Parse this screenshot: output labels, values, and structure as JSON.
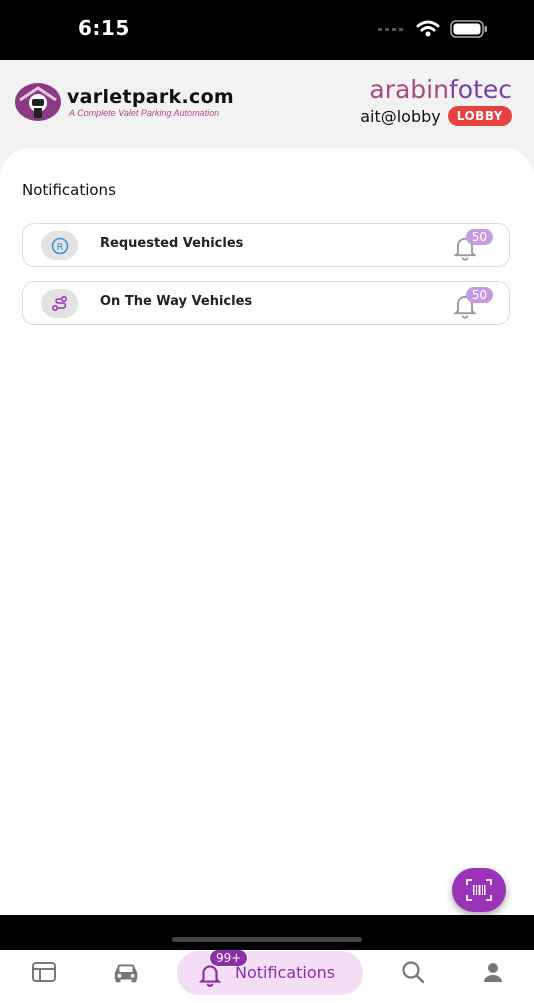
{
  "status_bar": {
    "time": "6:15"
  },
  "header": {
    "logo_name": "varletpark.com",
    "logo_tagline": "A Complete Valet Parking Automation",
    "brand_part1": "arabin",
    "brand_part2": "fotec",
    "user": "ait@lobby",
    "badge": "LOBBY"
  },
  "main": {
    "title": "Notifications",
    "items": [
      {
        "label": "Requested Vehicles",
        "count": "50",
        "icon": "registered-icon"
      },
      {
        "label": "On The Way Vehicles",
        "count": "50",
        "icon": "route-icon"
      }
    ]
  },
  "fab": {
    "icon": "barcode-scan-icon"
  },
  "bottom_nav": {
    "items": [
      {
        "icon": "dashboard-icon"
      },
      {
        "icon": "car-icon"
      },
      {
        "icon": "bell-icon",
        "label": "Notifications",
        "badge": "99+",
        "active": true
      },
      {
        "icon": "search-icon"
      },
      {
        "icon": "user-icon"
      }
    ]
  },
  "colors": {
    "accent": "#8c2fa8",
    "badge_red": "#e9413f",
    "count_badge": "#c89be0"
  }
}
